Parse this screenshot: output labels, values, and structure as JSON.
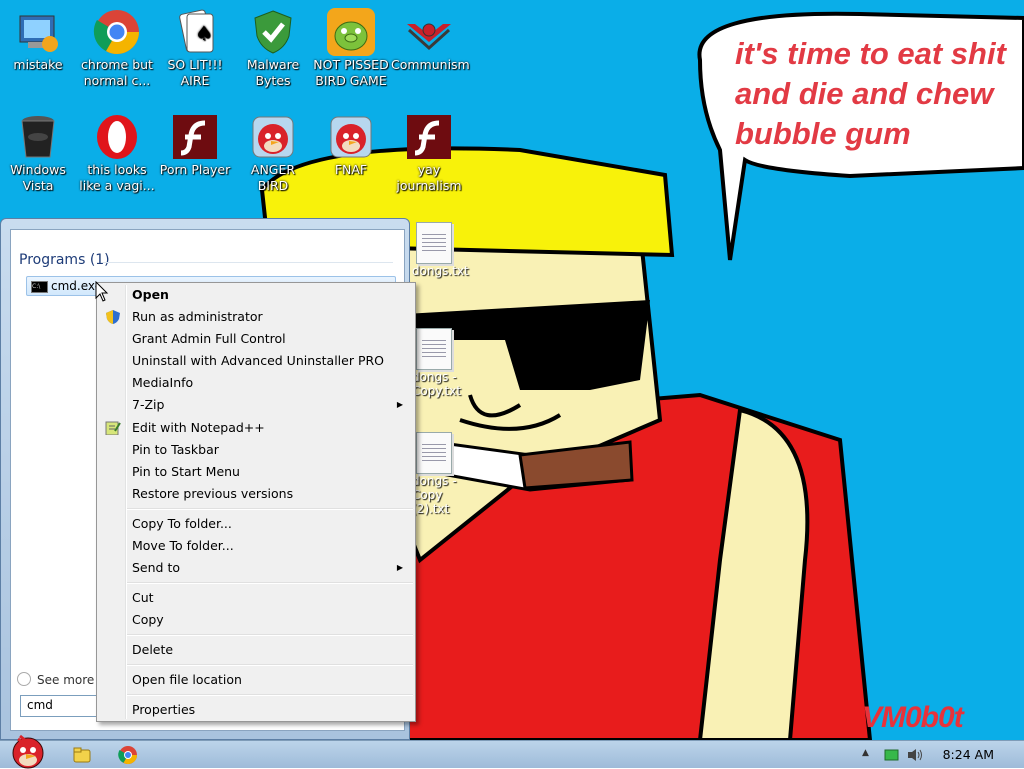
{
  "wallpaper": {
    "speech_bubble_text": "it's time to eat shit\nand die and chew\nbubble gum",
    "signature": "VM0b0t"
  },
  "desktop_icons": [
    {
      "label": "mistake",
      "icon": "computer-icon"
    },
    {
      "label": "chrome but normal c...",
      "icon": "chrome-icon"
    },
    {
      "label": "SO LIT!!! AIRE",
      "icon": "solitaire-icon"
    },
    {
      "label": "Malware Bytes",
      "icon": "shield-check-icon"
    },
    {
      "label": "NOT PISSED BIRD GAME",
      "icon": "green-pig-icon"
    },
    {
      "label": "Communism",
      "icon": "red-emblem-icon"
    },
    {
      "label": "Windows Vista",
      "icon": "trash-bin-icon"
    },
    {
      "label": "this looks like a vagi...",
      "icon": "opera-icon"
    },
    {
      "label": "Porn Player",
      "icon": "flash-icon"
    },
    {
      "label": "ANGER BIRD",
      "icon": "angry-bird-icon"
    },
    {
      "label": "FNAF",
      "icon": "angry-bird-icon"
    },
    {
      "label": "yay journalism",
      "icon": "flash-icon"
    }
  ],
  "desktop_files": [
    {
      "label": "dongs.txt"
    },
    {
      "label": "dongs - Copy.txt"
    },
    {
      "label": "dongs - Copy (2).txt"
    }
  ],
  "start_menu": {
    "programs_heading": "Programs (1)",
    "result": "cmd.exe",
    "see_more": "See more",
    "search_value": "cmd"
  },
  "context_menu": {
    "items": [
      {
        "label": "Open"
      },
      {
        "label": "Run as administrator"
      },
      {
        "label": "Grant Admin Full Control"
      },
      {
        "label": "Uninstall with Advanced Uninstaller PRO"
      },
      {
        "label": "MediaInfo"
      },
      {
        "label": "7-Zip"
      },
      {
        "label": "Edit with Notepad++"
      },
      {
        "label": "Pin to Taskbar"
      },
      {
        "label": "Pin to Start Menu"
      },
      {
        "label": "Restore previous versions"
      },
      {
        "label": "Copy To folder..."
      },
      {
        "label": "Move To folder..."
      },
      {
        "label": "Send to"
      },
      {
        "label": "Cut"
      },
      {
        "label": "Copy"
      },
      {
        "label": "Delete"
      },
      {
        "label": "Open file location"
      },
      {
        "label": "Properties"
      }
    ]
  },
  "taskbar": {
    "clock": "8:24 AM"
  }
}
